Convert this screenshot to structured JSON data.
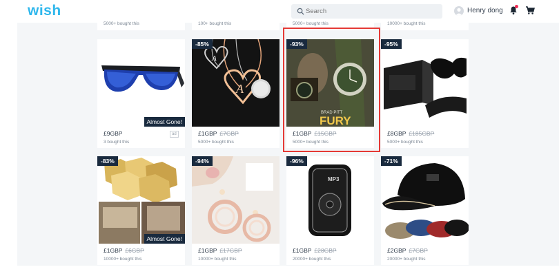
{
  "header": {
    "logo": "wish",
    "search_placeholder": "Search",
    "user_name": "Henry dong"
  },
  "top_row": [
    {
      "sold": "5000+ bought this"
    },
    {
      "sold": "100+ bought this"
    },
    {
      "sold": "5000+ bought this"
    },
    {
      "sold": "10000+ bought this"
    }
  ],
  "products": [
    {
      "price": "£9GBP",
      "old_price": "",
      "sold": "3 bought this",
      "badge": "",
      "almost_gone": "Almost Gone!",
      "ad": "ad"
    },
    {
      "price": "£1GBP",
      "old_price": "£7GBP",
      "sold": "5000+ bought this",
      "badge": "-85%"
    },
    {
      "price": "£1GBP",
      "old_price": "£15GBP",
      "sold": "5000+ bought this",
      "badge": "-93%",
      "poster_line1": "BRAD PITT",
      "poster_line2": "FURY"
    },
    {
      "price": "£8GBP",
      "old_price": "£185GBP",
      "sold": "5000+ bought this",
      "badge": "-95%"
    },
    {
      "price": "£1GBP",
      "old_price": "£6GBP",
      "sold": "10000+ bought this",
      "badge": "-83%",
      "almost_gone": "Almost Gone!"
    },
    {
      "price": "£1GBP",
      "old_price": "£17GBP",
      "sold": "10000+ bought this",
      "badge": "-94%"
    },
    {
      "price": "£1GBP",
      "old_price": "£28GBP",
      "sold": "20000+ bought this",
      "badge": "-96%",
      "device_label": "MP3"
    },
    {
      "price": "£2GBP",
      "old_price": "£7GBP",
      "sold": "20000+ bought this",
      "badge": "-71%"
    }
  ],
  "colors": {
    "brand": "#2fb7ec",
    "badge_bg": "#192a3e",
    "highlight": "#e53935"
  }
}
